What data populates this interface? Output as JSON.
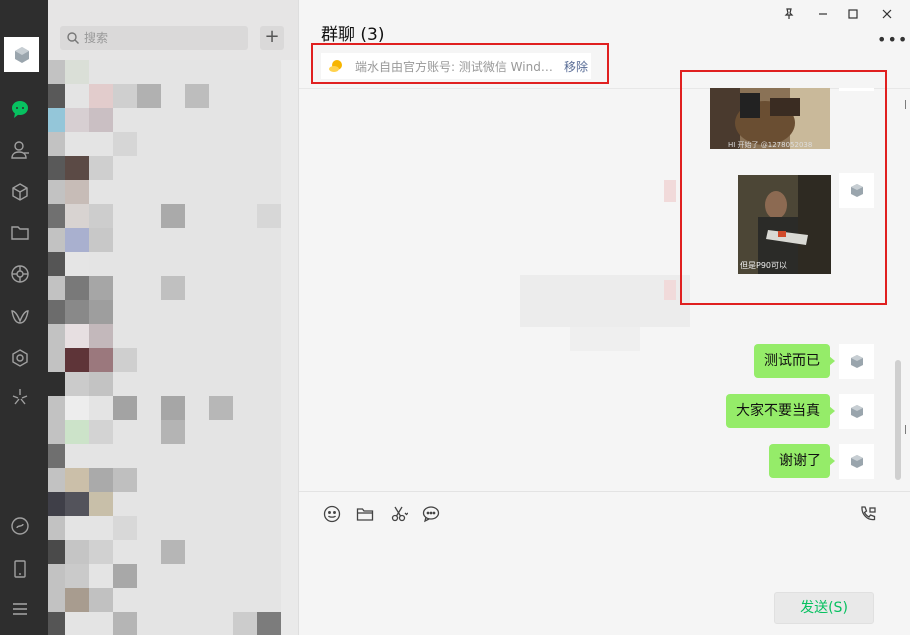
{
  "search": {
    "placeholder": "搜索"
  },
  "add_button": {
    "label": "+"
  },
  "chat": {
    "title": "群聊 (3)",
    "notice": {
      "text": "端水自由官方账号: 测试微信 Windo...",
      "remove_label": "移除"
    },
    "images": [
      {
        "caption": "HI 开始了 @1278052038"
      },
      {
        "caption": "但是P90可以"
      }
    ],
    "messages": [
      {
        "text": "测试而已"
      },
      {
        "text": "大家不要当真"
      },
      {
        "text": "谢谢了"
      }
    ]
  },
  "send_button": {
    "label": "发送(S)"
  },
  "colors": {
    "accent_green": "#07c160",
    "bubble_green": "#95ec69",
    "highlight_red": "#e02020",
    "link_blue": "#576b95"
  },
  "icons": {
    "nav": [
      "chat-icon",
      "contacts-icon",
      "collections-icon",
      "files-icon",
      "moments-icon",
      "channels-icon",
      "mini-programs-icon",
      "search-discover-icon",
      "mini-program-link-icon",
      "phone-icon",
      "menu-icon"
    ],
    "toolbar": [
      "emoji-icon",
      "folder-icon",
      "screenshot-icon",
      "chat-history-icon",
      "call-icon"
    ],
    "window": [
      "pin-icon",
      "minimize-icon",
      "maximize-icon",
      "close-icon",
      "more-icon"
    ]
  }
}
